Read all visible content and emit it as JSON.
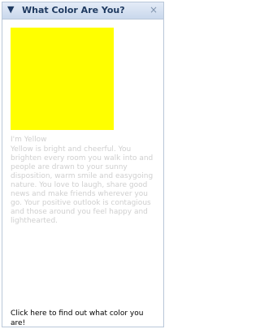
{
  "widget": {
    "title": "What Color Are You?",
    "icons": {
      "collapse": "collapse-triangle-icon",
      "close": "close-icon"
    },
    "result_color": "#ffff00",
    "result_heading": "I'm Yellow",
    "result_description": "Yellow is bright and cheerful. You brighten every room you walk into and people are drawn to your sunny disposition, warm smile and easygoing nature. You love to laugh, share good news and make friends wherever you go. Your positive outlook is contagious and those around you feel happy and lighthearted.",
    "cta": "Click here to find out what color you are!"
  }
}
